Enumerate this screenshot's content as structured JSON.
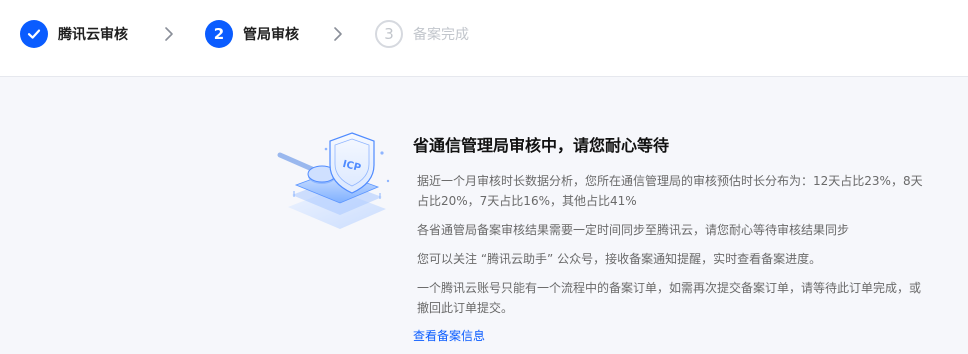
{
  "steps": [
    {
      "label": "腾讯云审核",
      "status": "done",
      "icon": "check-icon"
    },
    {
      "label": "管局审核",
      "status": "active",
      "number": "2"
    },
    {
      "label": "备案完成",
      "status": "todo",
      "number": "3"
    }
  ],
  "main": {
    "illustration_text": "ICP",
    "title": "省通信管理局审核中，请您耐心等待",
    "paragraphs": [
      "据近一个月审核时长数据分析，您所在通信管理局的审核预估时长分布为：12天占比23%，8天占比20%，7天占比16%，其他占比41%",
      "各省通管局备案审核结果需要一定时间同步至腾讯云，请您耐心等待审核结果同步",
      "您可以关注 “腾讯云助手” 公众号，接收备案通知提醒，实时查看备案进度。",
      "一个腾讯云账号只能有一个流程中的备案订单，如需再次提交备案订单，请等待此订单完成，或撤回此订单提交。"
    ],
    "link_label": "查看备案信息"
  },
  "colors": {
    "primary": "#0a5cff",
    "step_todo": "#c2c6cc",
    "text_secondary": "#6a6a6a",
    "background": "#f6f7fb"
  }
}
